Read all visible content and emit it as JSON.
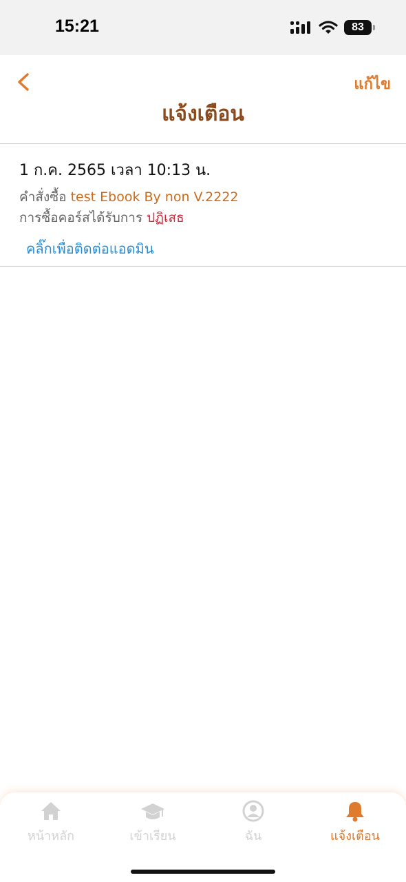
{
  "status_bar": {
    "time": "15:21",
    "battery": "83"
  },
  "header": {
    "title": "แจ้งเตือน",
    "edit_label": "แก้ไข"
  },
  "notification": {
    "date": "1 ก.ค. 2565 เวลา 10:13 น.",
    "order_prefix": "คำสั่งซื้อ ",
    "order_name": "test Ebook By non V.2222",
    "purchase_prefix": "การซื้อคอร์สได้รับการ ",
    "status": "ปฏิเสธ",
    "contact_link": "คลิ๊กเพื่อติดต่อแอดมิน"
  },
  "tabs": [
    {
      "label": "หน้าหลัก",
      "icon": "home-icon",
      "active": false
    },
    {
      "label": "เข้าเรียน",
      "icon": "graduation-cap-icon",
      "active": false
    },
    {
      "label": "ฉัน",
      "icon": "user-circle-icon",
      "active": false
    },
    {
      "label": "แจ้งเตือน",
      "icon": "bell-icon",
      "active": true
    }
  ],
  "colors": {
    "accent": "#e07a2c",
    "title": "#8b4a1c",
    "rejected": "#d6283b",
    "link": "#2a8dd6",
    "inactive_tab": "#d2d2d2"
  }
}
